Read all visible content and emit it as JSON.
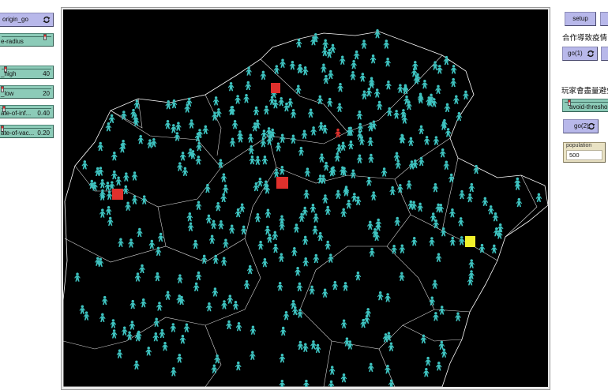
{
  "left_panel": {
    "origin_button": {
      "label": "origin_go",
      "icon": "loop-icon"
    },
    "sliders": [
      {
        "label": "e-radius",
        "value": "",
        "level": 0.88
      },
      {
        "label": "_high",
        "value": "40",
        "level": 0.06
      },
      {
        "label": "_low",
        "value": "20",
        "level": 0.0
      },
      {
        "label": "ate-of-inf...",
        "value": "0.40",
        "level": 0.04
      },
      {
        "label": "ate-of-vac...",
        "value": "0.20",
        "level": 0.0
      }
    ]
  },
  "right_panel": {
    "setup_button": "setup",
    "note_cooperation": "合作導致疫情",
    "go1_button": {
      "label": "go(1)",
      "icon": "loop-icon"
    },
    "note_avoid": "玩家會盡量避免",
    "avoid_slider": {
      "label": "avoid-thresho",
      "value": "",
      "level": 0.1
    },
    "go2_button": {
      "label": "go(2)",
      "icon": "loop-icon"
    },
    "population": {
      "label": "population",
      "value": "500"
    }
  },
  "world": {
    "agent_icon": "person-icon",
    "marker_icon": "square-patch"
  },
  "colors": {
    "view_bg": "#000000",
    "person": "#3ec3c0",
    "infected": "#e0302c",
    "highlight": "#f1f12b",
    "border_lines": "#ffffff",
    "button": "#b8b8ea",
    "slider": "#8ccbb8",
    "input": "#e9e2c4"
  }
}
